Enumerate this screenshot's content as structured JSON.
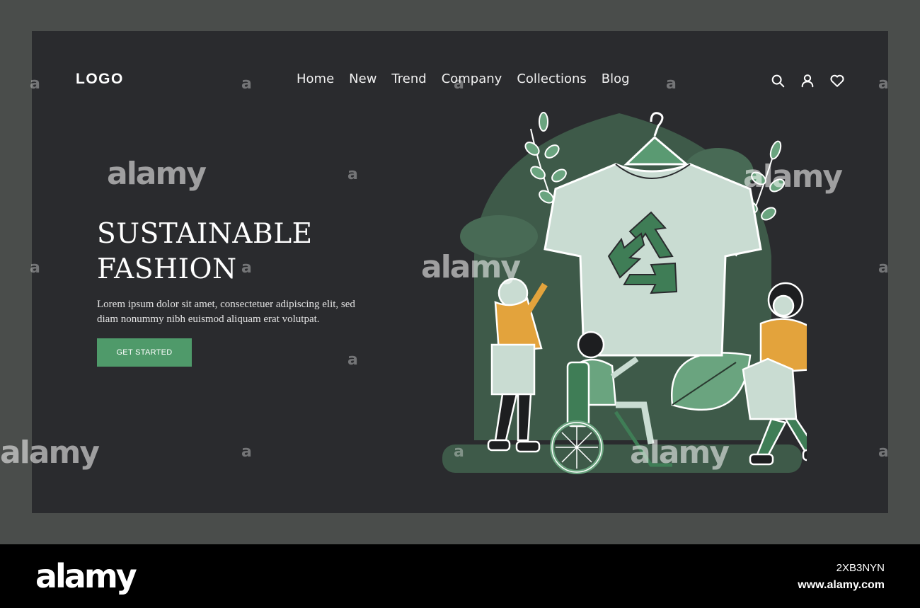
{
  "header": {
    "logo": "LOGO",
    "nav": [
      "Home",
      "New",
      "Trend",
      "Company",
      "Collections",
      "Blog"
    ],
    "icons": [
      "search-icon",
      "user-icon",
      "heart-icon"
    ]
  },
  "hero": {
    "title": "SUSTAINABLE FASHION",
    "description": "Lorem ipsum dolor sit amet, consectetuer adipiscing elit, sed diam nonummy nibh euismod aliquam erat volutpat.",
    "cta_label": "GET STARTED"
  },
  "illustration": {
    "subject": "recycle-tshirt-with-people",
    "icons": [
      "hanger-icon",
      "recycle-icon",
      "leaf-icon",
      "wheelchair-icon"
    ]
  },
  "colors": {
    "page_bg": "#4a4d4b",
    "card_bg": "#2a2b2e",
    "accent_green": "#4f9a6a",
    "blob_green": "#3e5a49",
    "tshirt": "#c9dcd2",
    "orange": "#e3a33c"
  },
  "watermark": {
    "text": "alamy",
    "small_mark": "a"
  },
  "footer": {
    "brand": "alamy",
    "image_id": "2XB3NYN",
    "url": "www.alamy.com"
  }
}
